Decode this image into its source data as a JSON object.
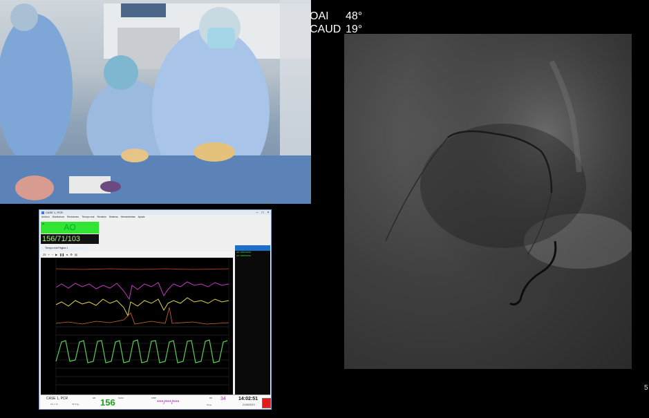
{
  "angles": [
    {
      "label": "OAI",
      "value": "48°"
    },
    {
      "label": "CAUD",
      "value": "19°"
    }
  ],
  "monitor": {
    "title": "CASE 1, PCR",
    "menu": [
      "Archivo",
      "Monitorizar",
      "Revisiones",
      "Tiempo real",
      "Revisión",
      "Sistema",
      "Herramientas",
      "Ayuda"
    ],
    "ao": {
      "label": "AO",
      "small": "P1"
    },
    "bp": "156/71/103",
    "tab": "Tiempo real Página 1",
    "toolbar_value": "25",
    "side_lines": [
      "AO: 156/71/103",
      "AO: 156/70/102"
    ],
    "ecg_ticks": [
      "200",
      "180",
      "160",
      "140",
      "120",
      "100",
      "80",
      "60",
      "40",
      "20",
      "0"
    ],
    "status": {
      "case": "CASE 1, PCR",
      "sub1": "SC 1.72",
      "sub2": "75.0 Kg",
      "hr_label": "HR",
      "hr": "156",
      "spo2_label": "SpO2",
      "nibp_label": "NIBP",
      "nibp": "***/***/***",
      "rr_label": "RR",
      "rr": "34",
      "temp_label": "Temp",
      "time": "14:02:51",
      "date": "21/05/2019"
    }
  }
}
